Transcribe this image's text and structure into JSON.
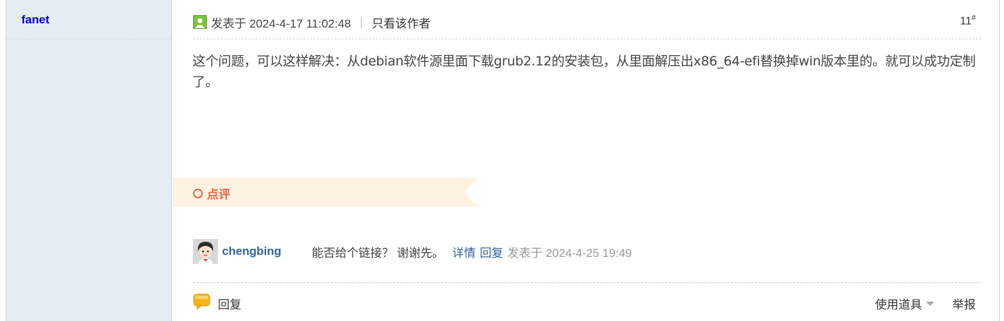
{
  "author": {
    "name": "fanet"
  },
  "post": {
    "posted_label": "发表于 2024-4-17 11:02:48",
    "separator": "|",
    "only_author": "只看该作者",
    "floor": "11",
    "floor_mark": "#",
    "content": "这个问题，可以这样解决：从debian软件源里面下载grub2.12的安装包，从里面解压出x86_64-efi替换掉win版本里的。就可以成功定制了。"
  },
  "comments_section": {
    "title": "点评"
  },
  "comment": {
    "user": "chengbing",
    "text": "能否给个链接？ 谢谢先。",
    "detail_link": "详情",
    "reply_link": "回复",
    "time": "发表于 2024-4-25 19:49"
  },
  "actions": {
    "reply": "回复",
    "use_tools": "使用道具",
    "report": "举报"
  },
  "colors": {
    "sidebar_bg": "#e5edf2",
    "link": "#336699",
    "accent": "#e46a45",
    "banner": "#fef3e0"
  }
}
